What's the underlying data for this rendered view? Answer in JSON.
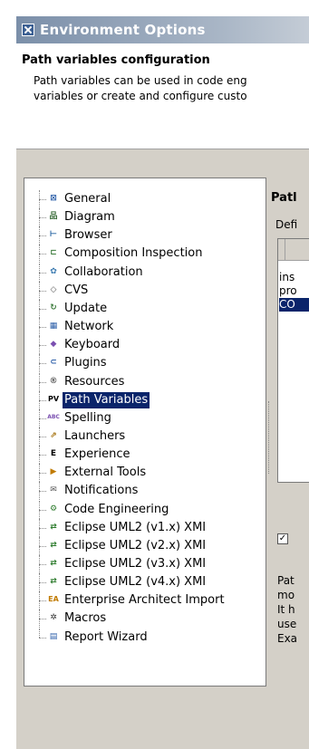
{
  "window": {
    "title": "Environment Options"
  },
  "header": {
    "title": "Path variables configuration",
    "desc_line1": "Path variables can be used in code eng",
    "desc_line2": "variables or create and configure custo"
  },
  "tree": {
    "items": [
      {
        "label": "General",
        "icon": "general-icon",
        "glyph": "⊠",
        "color": "#2b5ea8"
      },
      {
        "label": "Diagram",
        "icon": "diagram-icon",
        "glyph": "品",
        "color": "#3b6e3b"
      },
      {
        "label": "Browser",
        "icon": "browser-icon",
        "glyph": "⊢",
        "color": "#1f5fa0"
      },
      {
        "label": "Composition Inspection",
        "icon": "composition-inspection-icon",
        "glyph": "⊏",
        "color": "#3a7a3a"
      },
      {
        "label": "Collaboration",
        "icon": "collaboration-icon",
        "glyph": "✿",
        "color": "#3a7ab0"
      },
      {
        "label": "CVS",
        "icon": "cvs-icon",
        "glyph": "◇",
        "color": "#555555"
      },
      {
        "label": "Update",
        "icon": "update-icon",
        "glyph": "↻",
        "color": "#3a7a3a"
      },
      {
        "label": "Network",
        "icon": "network-icon",
        "glyph": "▦",
        "color": "#2b5ea8"
      },
      {
        "label": "Keyboard",
        "icon": "keyboard-icon",
        "glyph": "◆",
        "color": "#7a4fb0"
      },
      {
        "label": "Plugins",
        "icon": "plugins-icon",
        "glyph": "⊂",
        "color": "#2b5ea8"
      },
      {
        "label": "Resources",
        "icon": "resources-icon",
        "glyph": "®",
        "color": "#555555"
      },
      {
        "label": "Path Variables",
        "icon": "path-variables-icon",
        "glyph": "PV",
        "color": "#000000"
      },
      {
        "label": "Spelling",
        "icon": "spelling-icon",
        "glyph": "ABC",
        "color": "#7a4fb0"
      },
      {
        "label": "Launchers",
        "icon": "launchers-icon",
        "glyph": "⇗",
        "color": "#a06a00"
      },
      {
        "label": "Experience",
        "icon": "experience-icon",
        "glyph": "E",
        "color": "#000000"
      },
      {
        "label": "External Tools",
        "icon": "external-tools-icon",
        "glyph": "▶",
        "color": "#c07a00"
      },
      {
        "label": "Notifications",
        "icon": "notifications-icon",
        "glyph": "✉",
        "color": "#555555"
      },
      {
        "label": "Code Engineering",
        "icon": "code-engineering-icon",
        "glyph": "⚙",
        "color": "#2b7a2b"
      },
      {
        "label": "Eclipse UML2 (v1.x) XMI",
        "icon": "eclipse-uml2-icon",
        "glyph": "⇄",
        "color": "#2b7a2b"
      },
      {
        "label": "Eclipse UML2 (v2.x) XMI",
        "icon": "eclipse-uml2-icon",
        "glyph": "⇄",
        "color": "#2b7a2b"
      },
      {
        "label": "Eclipse UML2 (v3.x) XMI",
        "icon": "eclipse-uml2-icon",
        "glyph": "⇄",
        "color": "#2b7a2b"
      },
      {
        "label": "Eclipse UML2 (v4.x) XMI",
        "icon": "eclipse-uml2-icon",
        "glyph": "⇄",
        "color": "#2b7a2b"
      },
      {
        "label": "Enterprise Architect Import",
        "icon": "enterprise-architect-icon",
        "glyph": "EA",
        "color": "#c07a00"
      },
      {
        "label": "Macros",
        "icon": "macros-icon",
        "glyph": "✲",
        "color": "#333333"
      },
      {
        "label": "Report Wizard",
        "icon": "report-wizard-icon",
        "glyph": "▤",
        "color": "#2b5ea8"
      }
    ],
    "selected_index": 11
  },
  "right_panel": {
    "title": "Patl",
    "list_label": "Defi",
    "rows": [
      "ins",
      "pro",
      "CO"
    ],
    "selected_row": 2,
    "checkbox_mark": "✓",
    "desc_lines": [
      "Pat",
      "mo",
      "It h",
      "use",
      "Exa"
    ]
  },
  "colors": {
    "selection": "#0a246a",
    "window_bg": "#d4d0c8"
  }
}
